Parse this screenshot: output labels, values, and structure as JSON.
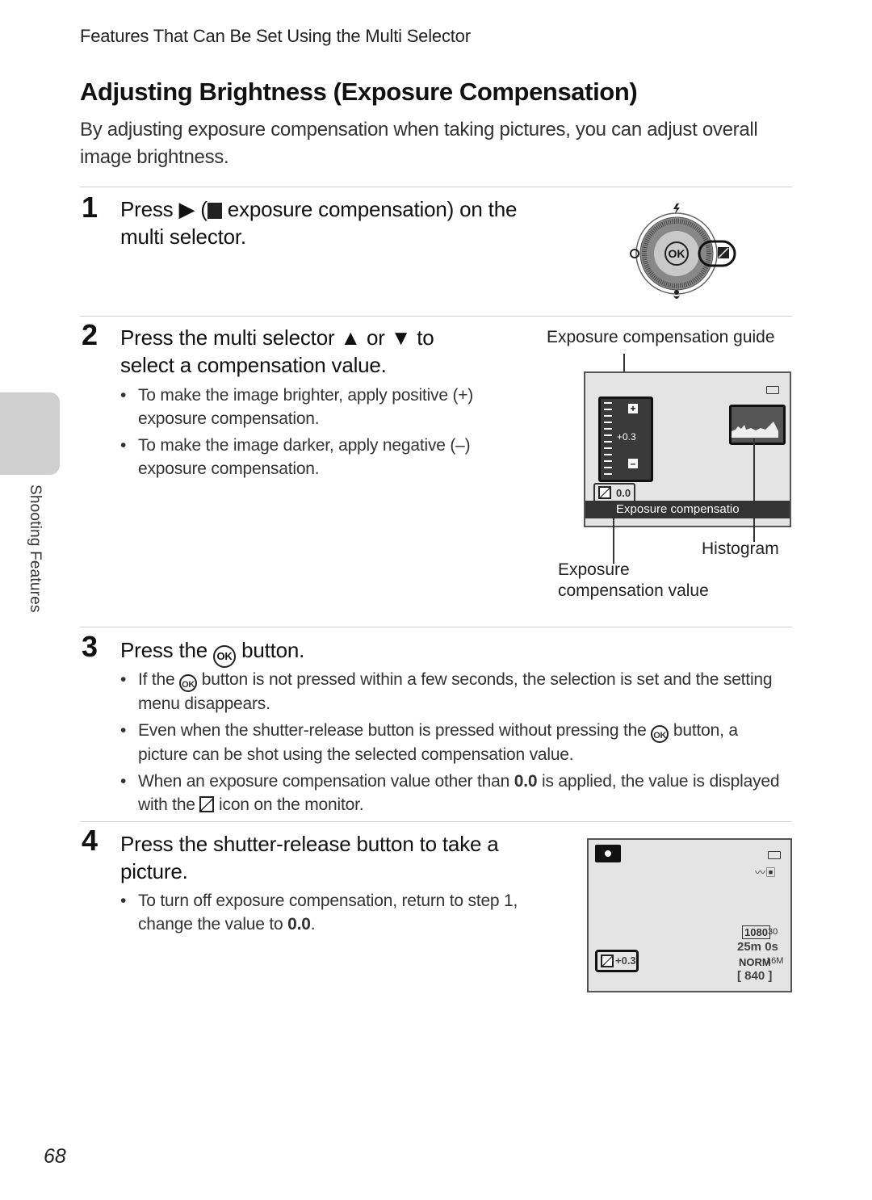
{
  "running_head": "Features That Can Be Set Using the Multi Selector",
  "title": "Adjusting Brightness (Exposure Compensation)",
  "intro": "By adjusting exposure compensation when taking pictures, you can adjust overall image brightness.",
  "side_tab": {
    "label": "Shooting Features"
  },
  "page_number": "68",
  "steps": [
    {
      "number": "1",
      "title_a": "Press ▶ (",
      "title_b": " exposure compensation) on the multi selector."
    },
    {
      "number": "2",
      "title": "Press the multi selector ▲ or ▼ to select a compensation value.",
      "bullets": [
        "To make the image brighter, apply positive (+) exposure compensation.",
        "To make the image darker, apply negative (–) exposure compensation."
      ]
    },
    {
      "number": "3",
      "title_a": "Press the ",
      "title_b": " button.",
      "bullets": [
        {
          "a": "If the ",
          "b": " button is not pressed within a few seconds, the selection is set and the setting menu disappears."
        },
        {
          "a": "Even when the shutter-release button is pressed without pressing the ",
          "b": " button, a picture can be shot using the selected compensation value."
        },
        {
          "a": "When an exposure compensation value other than ",
          "bold": "0.0",
          "b": " is applied, the value is displayed with the ",
          "c": " icon on the monitor."
        }
      ]
    },
    {
      "number": "4",
      "title": "Press the shutter-release button to take a picture.",
      "bullets": [
        {
          "a": "To turn off exposure compensation, return to step 1, change the value to ",
          "bold": "0.0",
          "b": "."
        }
      ]
    }
  ],
  "multi_selector": {
    "ok_label": "OK",
    "icons": [
      "flash-icon",
      "self-timer-icon",
      "macro-icon",
      "exposure-compensation-icon"
    ]
  },
  "exposure_screen": {
    "callout_guide": "Exposure compensation guide",
    "callout_histogram": "Histogram",
    "callout_value_line1": "Exposure",
    "callout_value_line2": "compensation value",
    "guide_value": "+0.3",
    "guide_plus": "+",
    "guide_minus": "–",
    "current_value": "0.0",
    "menu_bar_text": "Exposure compensatio"
  },
  "shooting_screen": {
    "ev_value": "+0.3",
    "movie_res": "1080",
    "movie_fps": "30",
    "rec_time": "25m 0s",
    "quality": "NORM",
    "size": "16M",
    "shots_remaining": "840"
  }
}
